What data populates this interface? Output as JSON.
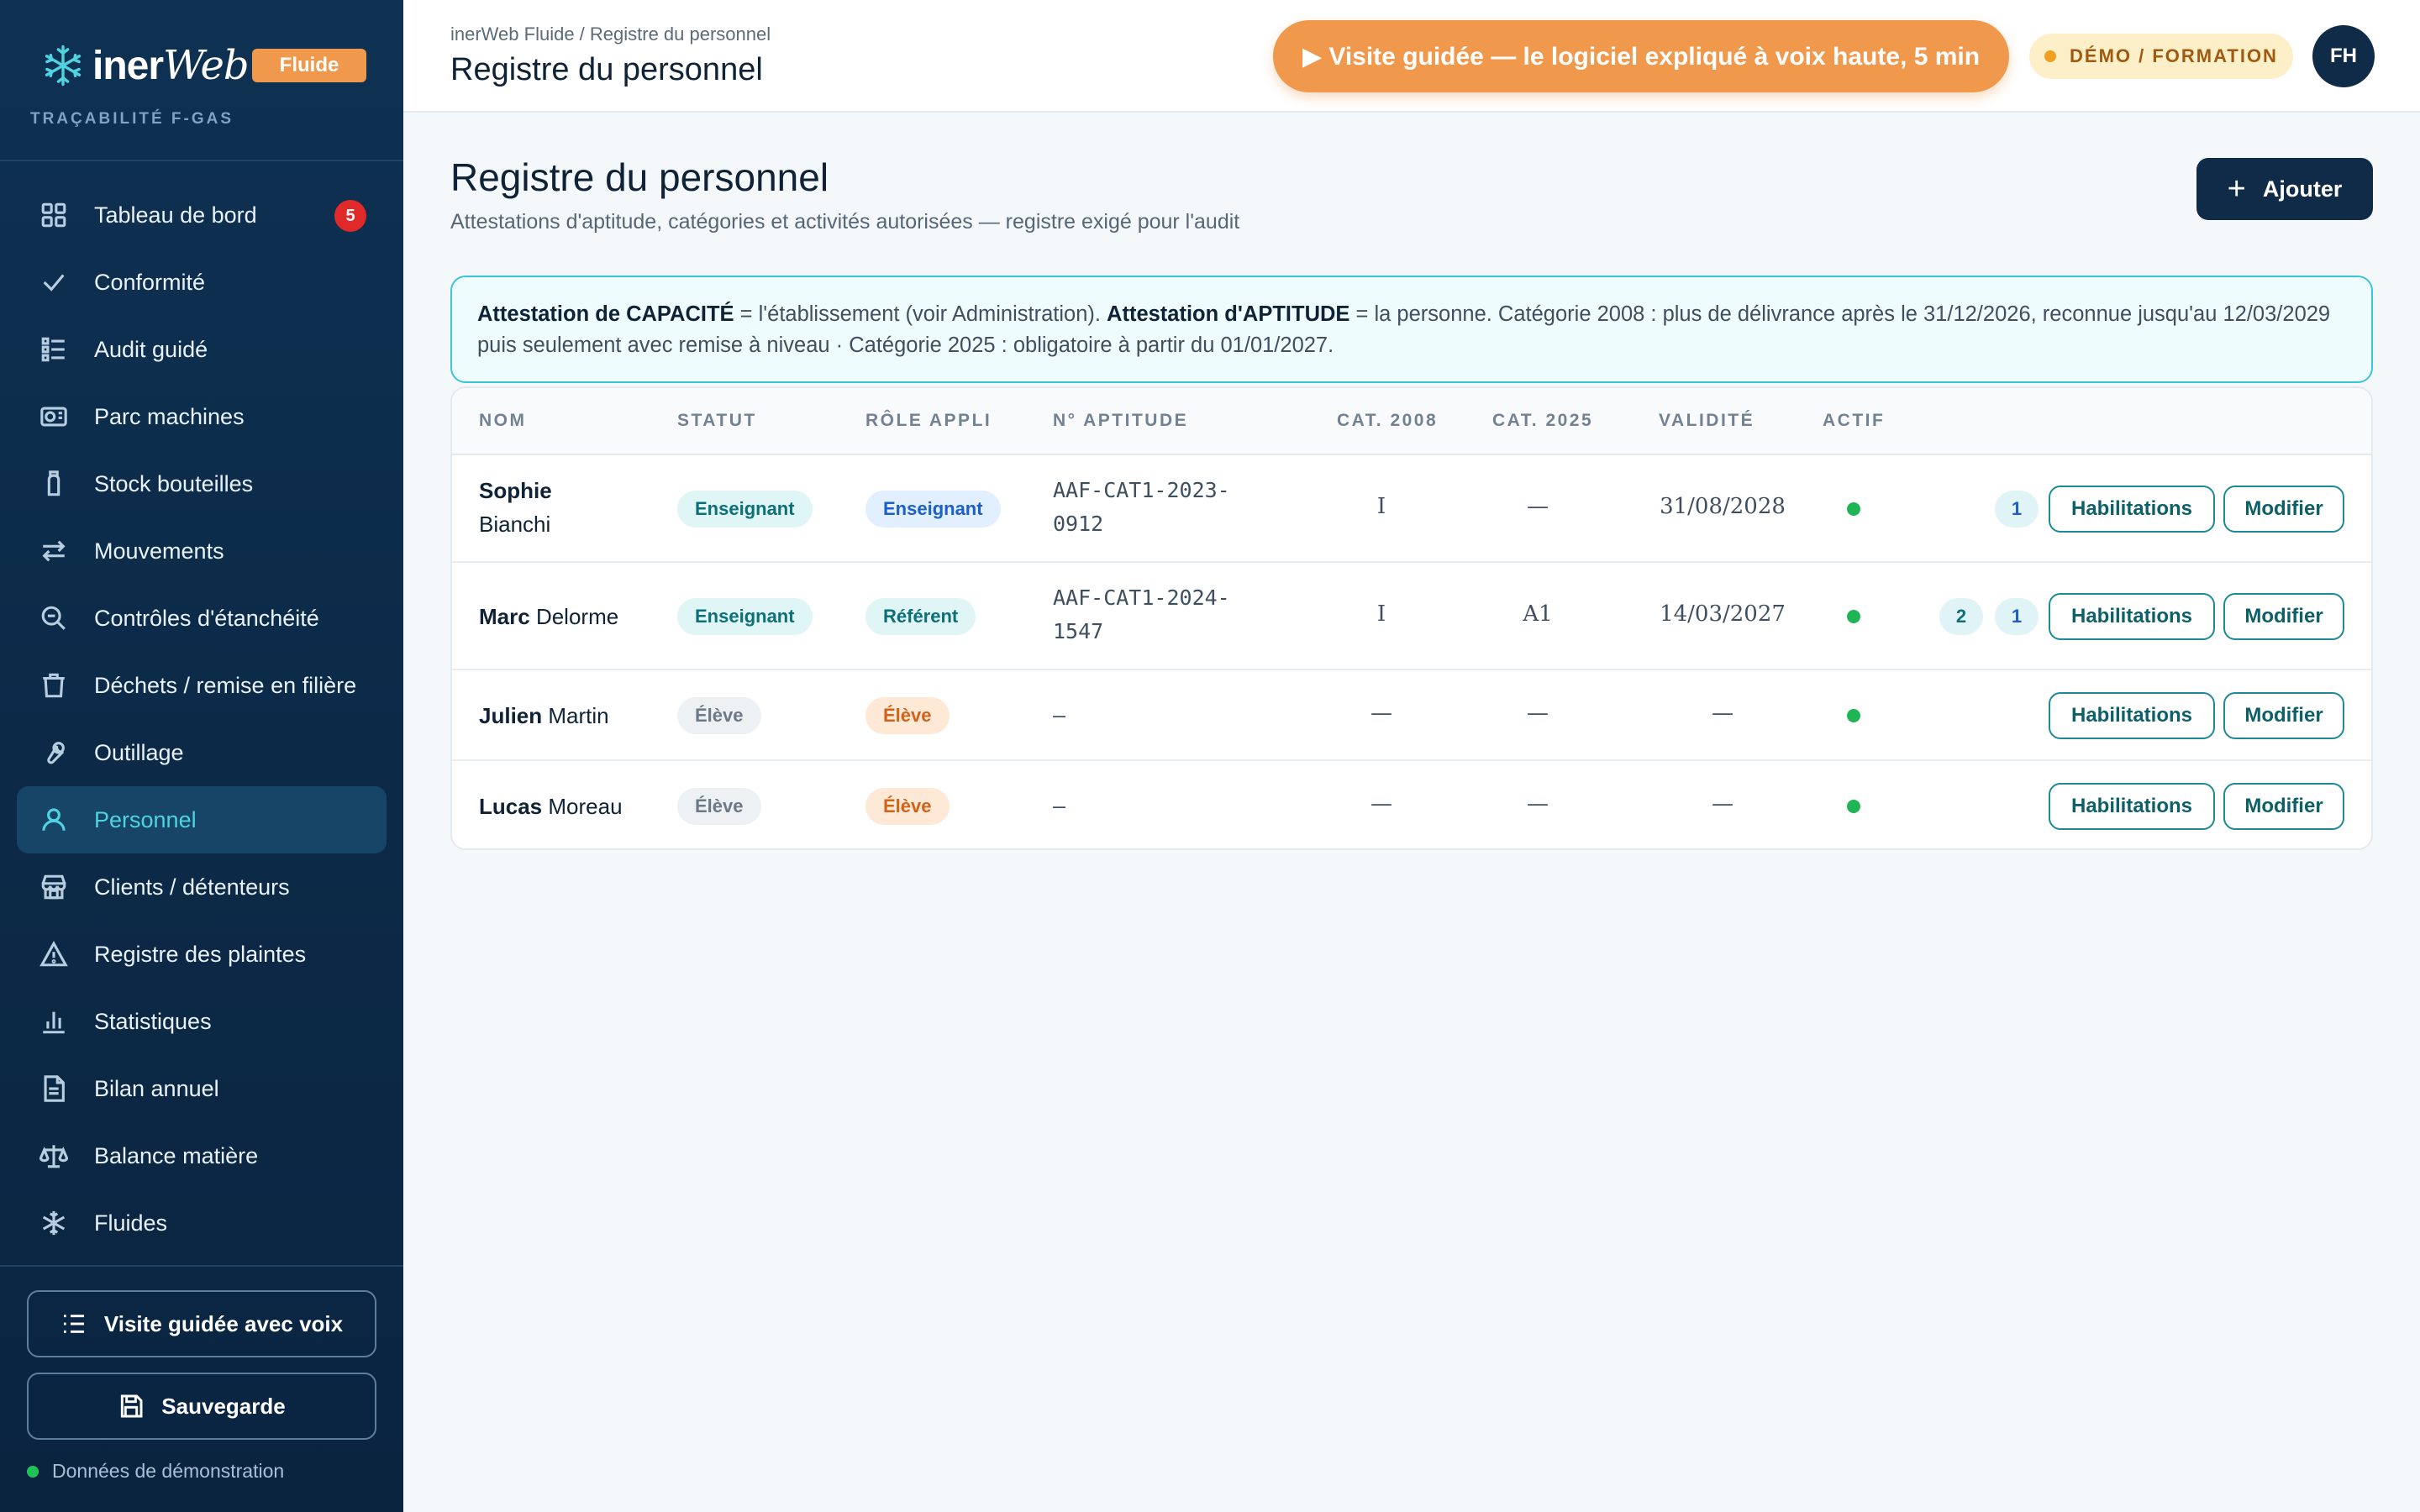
{
  "brand": {
    "name_prefix": "iner",
    "name_suffix": "Web",
    "pill": "Fluide",
    "subtitle": "TRAÇABILITÉ F-GAS"
  },
  "sidebar": {
    "items": [
      {
        "label": "Tableau de bord",
        "icon": "grid-icon",
        "badge": "5"
      },
      {
        "label": "Conformité",
        "icon": "check-icon"
      },
      {
        "label": "Audit guidé",
        "icon": "list-check-icon"
      },
      {
        "label": "Parc machines",
        "icon": "machine-icon"
      },
      {
        "label": "Stock bouteilles",
        "icon": "bottle-icon"
      },
      {
        "label": "Mouvements",
        "icon": "arrows-icon"
      },
      {
        "label": "Contrôles d'étanchéité",
        "icon": "search-icon"
      },
      {
        "label": "Déchets / remise en filière",
        "icon": "trash-icon"
      },
      {
        "label": "Outillage",
        "icon": "wrench-icon"
      },
      {
        "label": "Personnel",
        "icon": "user-icon",
        "active": true
      },
      {
        "label": "Clients / détenteurs",
        "icon": "store-icon"
      },
      {
        "label": "Registre des plaintes",
        "icon": "warning-icon"
      },
      {
        "label": "Statistiques",
        "icon": "bar-chart-icon"
      },
      {
        "label": "Bilan annuel",
        "icon": "document-icon"
      },
      {
        "label": "Balance matière",
        "icon": "scale-icon"
      },
      {
        "label": "Fluides",
        "icon": "snowflake-icon"
      }
    ],
    "tour_button": "Visite guidée avec voix",
    "save_button": "Sauvegarde",
    "demo_status": "Données de démonstration"
  },
  "topbar": {
    "breadcrumb": "inerWeb Fluide / Registre du personnel",
    "title": "Registre du personnel",
    "tour_button": "▶ Visite guidée — le logiciel expliqué à voix haute, 5 min",
    "demo_badge": "DÉMO / FORMATION",
    "avatar": "FH"
  },
  "main": {
    "title": "Registre du personnel",
    "subtitle": "Attestations d'aptitude, catégories et activités autorisées — registre exigé pour l'audit",
    "add_button": "Ajouter",
    "info": {
      "b1": "Attestation de CAPACITÉ",
      "t1": " = l'établissement (voir Administration). ",
      "b2": "Attestation d'APTITUDE",
      "t2": " = la personne. Catégorie 2008 : plus de délivrance après le 31/12/2026, reconnue jusqu'au 12/03/2029 puis seulement avec remise à niveau · Catégorie 2025 : obligatoire à partir du 01/01/2027."
    },
    "table": {
      "headers": [
        "NOM",
        "STATUT",
        "RÔLE APPLI",
        "N° APTITUDE",
        "CAT. 2008",
        "CAT. 2025",
        "VALIDITÉ",
        "ACTIF"
      ],
      "rows": [
        {
          "first": "Sophie",
          "last": "Bianchi",
          "statut": "Enseignant",
          "role": "Enseignant",
          "aptitude_1": "AAF-CAT1-2023-",
          "aptitude_2": "0912",
          "cat2008": "I",
          "cat2025": "—",
          "validite": "31/08/2028",
          "counts": [
            "1"
          ]
        },
        {
          "first": "Marc",
          "last": "Delorme",
          "statut": "Enseignant",
          "role": "Référent",
          "aptitude_1": "AAF-CAT1-2024-",
          "aptitude_2": "1547",
          "cat2008": "I",
          "cat2025": "A1",
          "validite": "14/03/2027",
          "counts": [
            "2",
            "1"
          ]
        },
        {
          "first": "Julien",
          "last": "Martin",
          "statut": "Élève",
          "role": "Élève",
          "aptitude_1": "—",
          "aptitude_2": "",
          "cat2008": "—",
          "cat2025": "—",
          "validite": "—",
          "counts": []
        },
        {
          "first": "Lucas",
          "last": "Moreau",
          "statut": "Élève",
          "role": "Élève",
          "aptitude_1": "—",
          "aptitude_2": "",
          "cat2008": "—",
          "cat2025": "—",
          "validite": "—",
          "counts": []
        }
      ],
      "habilitations_label": "Habilitations",
      "modifier_label": "Modifier"
    }
  },
  "colors": {
    "accent_orange": "#f0984c",
    "sidebar_bg": "#0c2a48",
    "active_teal": "#4fd3e0",
    "badge_red": "#e02a2a",
    "active_green": "#1fb555"
  }
}
